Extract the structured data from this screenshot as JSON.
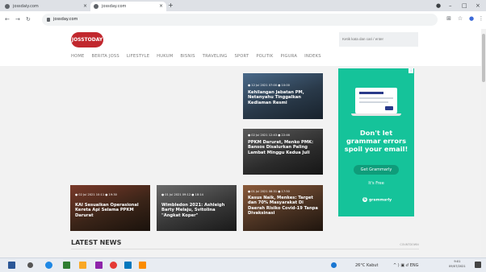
{
  "browser": {
    "tabs": [
      {
        "label": "jossdaiy.com"
      },
      {
        "label": "jossday.com"
      }
    ],
    "new_tab": "+",
    "url": "jossday.com",
    "window_controls": [
      "–",
      "□",
      "×"
    ]
  },
  "site": {
    "logo": "JOSSTODAY",
    "search_placeholder": "Ketik kata dan cari / enter",
    "menu": [
      "HOME",
      "BERITA JOSS",
      "LIFESTYLE",
      "HUKUM",
      "BISNIS",
      "TRAVELING",
      "SPORT",
      "POLITIK",
      "PIGURA",
      "INDEKS"
    ]
  },
  "articles": [
    {
      "meta": "● 12 Jul 2021 07:00   ● 10:00",
      "title": "Kehilangan Jabatan PM, Netanyahu Tinggalkan Kediaman Resmi"
    },
    {
      "meta": "● 02 Jul 2021 12:43   ● 22:46",
      "title": "PPKM Darurat, Menko PMK: Bansos Disalurkan Paling Lambat Minggu Kedua Juli"
    },
    {
      "meta": "● 02 Jul 2021 10:11   ● 19:30",
      "title": "KAI Sesuaikan Operasional Kereta Api Selama PPKM Darurat"
    },
    {
      "meta": "● 01 Jul 2021 09:12   ● 18:14",
      "title": "Wimbledon 2021: Ashleigh Barty Melaju, Svitolina \"Angkat Koper\""
    },
    {
      "meta": "● 01 Jul 2021 08:31   ● 17:50",
      "title": "Kasus Naik, Menkes: Target dan 70% Masyarakat Di Daerah Risiko Covid-19 Tanpa Divaksinasi"
    }
  ],
  "ad": {
    "headline": "Don't let grammar errors spoil your email!",
    "cta": "Get Grammarly",
    "sub": "It's Free",
    "brand": "grammarly",
    "brand_letter": "G",
    "info": "i"
  },
  "section": {
    "latest_news": "LATEST NEWS",
    "countdown": "COUNTDOWN"
  },
  "taskbar": {
    "weather": "26°C Kabut",
    "tray": "^  ⟩  ▣  ⅆ  ENG",
    "time": "9:01",
    "date": "09/07/2021"
  }
}
